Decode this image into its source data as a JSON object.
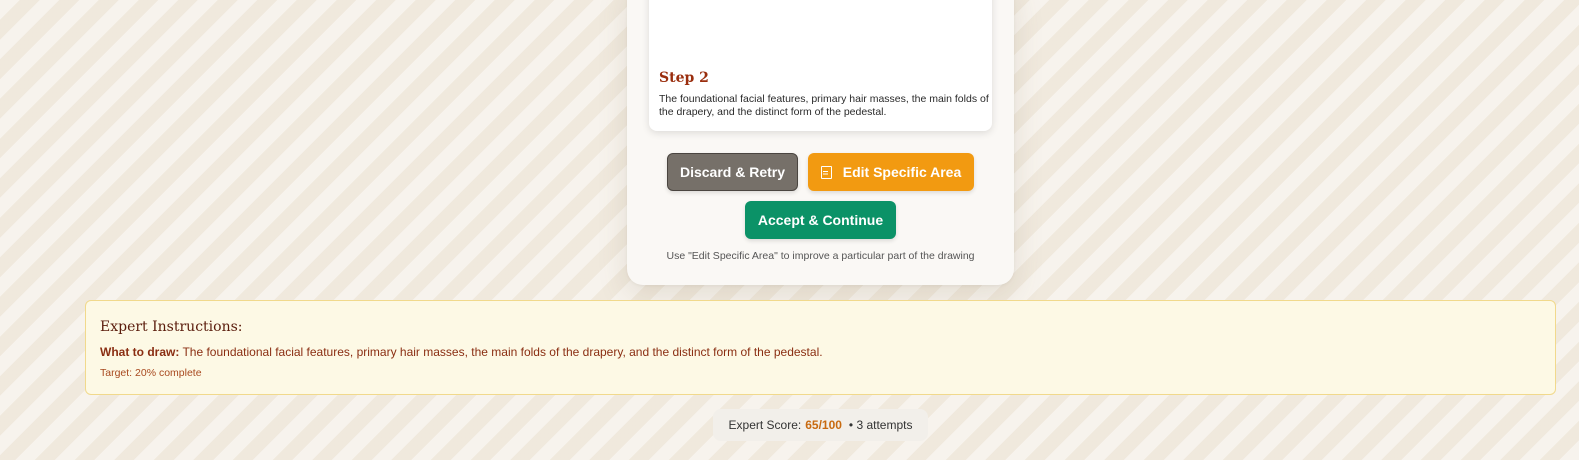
{
  "step": {
    "title": "Step 2",
    "description": "The foundational facial features, primary hair masses, the main folds of the drapery, and the distinct form of the pedestal."
  },
  "actions": {
    "discard_label": "Discard & Retry",
    "edit_label": "Edit Specific Area",
    "edit_icon": "document-edit-icon",
    "accept_label": "Accept & Continue",
    "hint": "Use \"Edit Specific Area\" to improve a particular part of the drawing"
  },
  "instructions": {
    "title": "Expert Instructions:",
    "what_label": "What to draw:",
    "what_text": "The foundational facial features, primary hair masses, the main folds of the drapery, and the distinct form of the pedestal.",
    "target": "Target: 20% complete"
  },
  "score": {
    "label": "Expert Score:",
    "value": "65/100",
    "attempts": "• 3 attempts"
  },
  "colors": {
    "discard": "#767069",
    "edit": "#f29a11",
    "accept": "#0b9267",
    "step_title": "#9a2e0e",
    "score_value": "#c86a10"
  }
}
